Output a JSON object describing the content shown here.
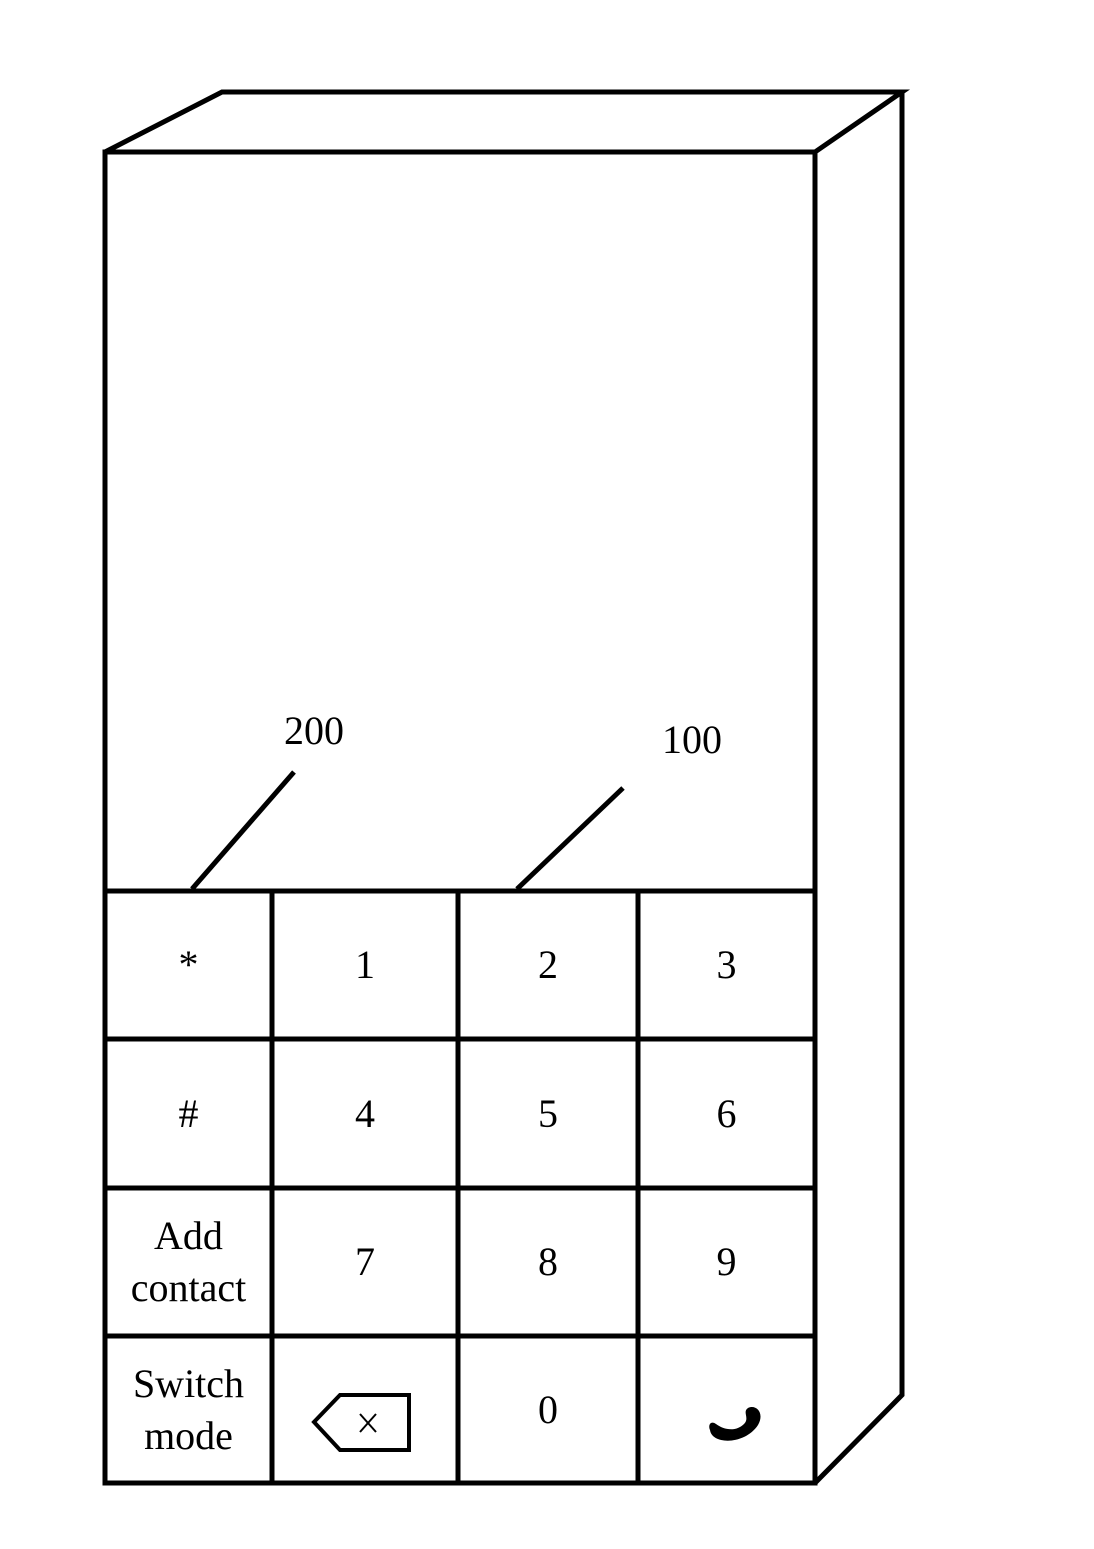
{
  "figure": {
    "reference_labels": {
      "keypad_area": "200",
      "key_area": "100"
    },
    "keypad": {
      "rows": [
        [
          {
            "label": "*"
          },
          {
            "label": "1"
          },
          {
            "label": "2"
          },
          {
            "label": "3"
          }
        ],
        [
          {
            "label": "#"
          },
          {
            "label": "4"
          },
          {
            "label": "5"
          },
          {
            "label": "6"
          }
        ],
        [
          {
            "label": "Add",
            "label2": "contact"
          },
          {
            "label": "7"
          },
          {
            "label": "8"
          },
          {
            "label": "9"
          }
        ],
        [
          {
            "label": "Switch",
            "label2": "mode"
          },
          {
            "icon": "backspace-icon"
          },
          {
            "label": "0"
          },
          {
            "icon": "phone-call-icon"
          }
        ]
      ]
    },
    "colors": {
      "line": "#000000",
      "background": "#ffffff"
    }
  }
}
